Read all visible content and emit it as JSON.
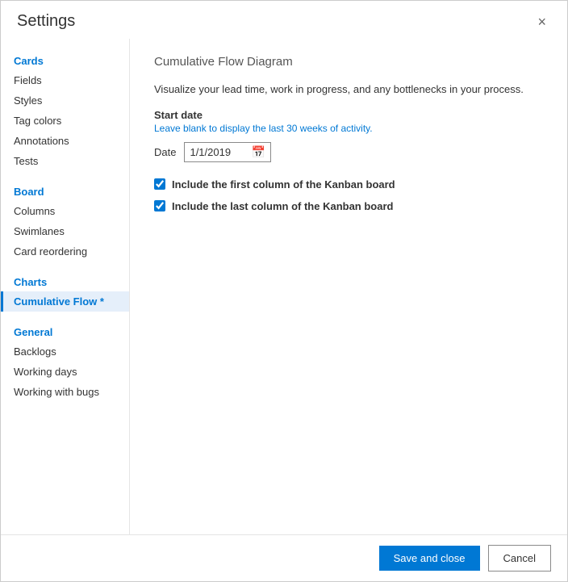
{
  "dialog": {
    "title": "Settings",
    "close_label": "×"
  },
  "sidebar": {
    "sections": [
      {
        "label": "Cards",
        "items": [
          {
            "label": "Fields",
            "active": false
          },
          {
            "label": "Styles",
            "active": false
          },
          {
            "label": "Tag colors",
            "active": false
          },
          {
            "label": "Annotations",
            "active": false
          },
          {
            "label": "Tests",
            "active": false
          }
        ]
      },
      {
        "label": "Board",
        "items": [
          {
            "label": "Columns",
            "active": false
          },
          {
            "label": "Swimlanes",
            "active": false
          },
          {
            "label": "Card reordering",
            "active": false
          }
        ]
      },
      {
        "label": "Charts",
        "items": [
          {
            "label": "Cumulative Flow *",
            "active": true
          }
        ]
      },
      {
        "label": "General",
        "items": [
          {
            "label": "Backlogs",
            "active": false
          },
          {
            "label": "Working days",
            "active": false
          },
          {
            "label": "Working with bugs",
            "active": false
          }
        ]
      }
    ]
  },
  "main": {
    "content_title": "Cumulative Flow Diagram",
    "description": "Visualize your lead time, work in progress, and any bottlenecks in your process.",
    "start_date_label": "Start date",
    "start_date_hint": "Leave blank to display the last 30 weeks of activity.",
    "date_label": "Date",
    "date_value": "1/1/2019",
    "calendar_icon": "📅",
    "checkbox1_label": "Include the first column of the Kanban board",
    "checkbox2_label": "Include the last column of the Kanban board"
  },
  "footer": {
    "save_label": "Save and close",
    "cancel_label": "Cancel"
  }
}
